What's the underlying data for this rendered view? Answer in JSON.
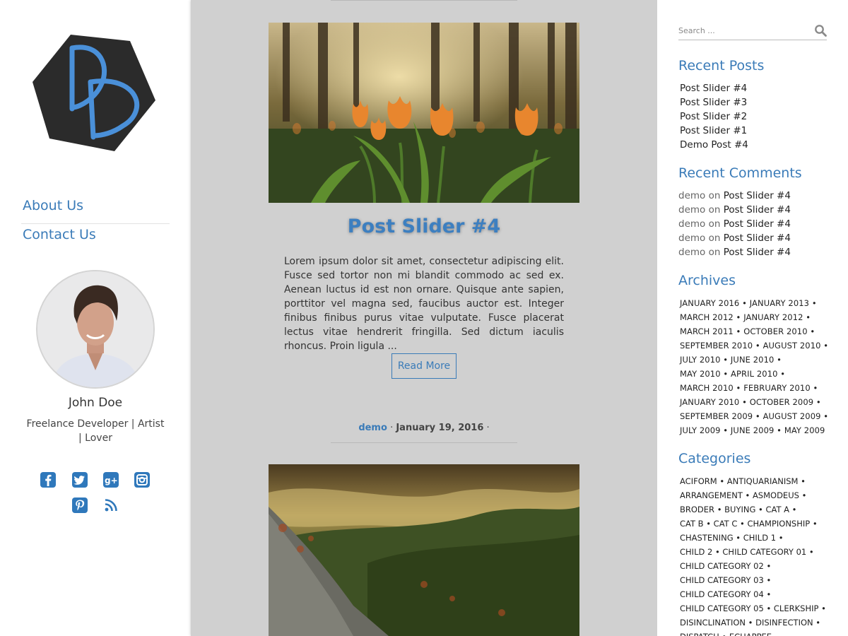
{
  "nav": {
    "items": [
      {
        "label": "About Us"
      },
      {
        "label": "Contact Us"
      }
    ]
  },
  "author": {
    "name": "John Doe",
    "bio": "Freelance Developer | Artist | Lover"
  },
  "social_icons": [
    "facebook-icon",
    "twitter-icon",
    "google-plus-icon",
    "instagram-icon",
    "pinterest-icon",
    "rss-icon"
  ],
  "post": {
    "title": "Post Slider #4",
    "excerpt": "Lorem ipsum dolor sit amet, consectetur adipiscing elit. Fusce sed tortor non mi blandit commodo ac sed ex. Aenean luctus id est non ornare. Quisque ante sapien, porttitor vel magna sed, faucibus auctor est. Integer finibus finibus purus vitae vulputate. Fusce placerat lectus vitae hendrerit fringilla. Sed dictum iaculis rhoncus. Proin ligula ...",
    "read_more": "Read More"
  },
  "next_post_meta": {
    "author": "demo",
    "separator": "·",
    "date": "January 19, 2016",
    "trail": "·"
  },
  "search": {
    "placeholder": "Search ..."
  },
  "recent_posts": {
    "title": "Recent Posts",
    "items": [
      "Post Slider #4",
      "Post Slider #3",
      "Post Slider #2",
      "Post Slider #1",
      "Demo Post #4"
    ]
  },
  "recent_comments": {
    "title": "Recent Comments",
    "items": [
      {
        "author": "demo",
        "on": "on",
        "post": "Post Slider #4"
      },
      {
        "author": "demo",
        "on": "on",
        "post": "Post Slider #4"
      },
      {
        "author": "demo",
        "on": "on",
        "post": "Post Slider #4"
      },
      {
        "author": "demo",
        "on": "on",
        "post": "Post Slider #4"
      },
      {
        "author": "demo",
        "on": "on",
        "post": "Post Slider #4"
      }
    ]
  },
  "archives": {
    "title": "Archives",
    "lines": [
      "JANUARY 2016 • JANUARY 2013 •",
      "MARCH 2012 • JANUARY 2012 •",
      "MARCH 2011 • OCTOBER 2010 •",
      "SEPTEMBER 2010 • AUGUST 2010 •",
      "JULY 2010 • JUNE 2010 •",
      "MAY 2010 • APRIL 2010 •",
      "MARCH 2010 • FEBRUARY 2010 •",
      "JANUARY 2010 • OCTOBER 2009 •",
      "SEPTEMBER 2009 • AUGUST 2009 •",
      "JULY 2009 • JUNE 2009 • MAY 2009"
    ]
  },
  "categories": {
    "title": "Categories",
    "lines": [
      "ACIFORM  • ANTIQUARIANISM  •",
      "ARRANGEMENT  • ASMODEUS  •",
      "BRODER  • BUYING  • CAT A  •",
      "CAT B  • CAT C  • CHAMPIONSHIP  •",
      "CHASTENING  • CHILD 1  •",
      "CHILD 2  • CHILD CATEGORY 01  •",
      "CHILD CATEGORY 02  •",
      "CHILD CATEGORY 03  •",
      "CHILD CATEGORY 04  •",
      "CHILD CATEGORY 05  • CLERKSHIP  •",
      "DISINCLINATION  • DISINFECTION  •",
      "DISPATCH  • ECHAPPEE"
    ]
  },
  "colors": {
    "accent": "#3a7bb8",
    "main_bg": "#d0d0d0",
    "social": "#2f78bb"
  }
}
